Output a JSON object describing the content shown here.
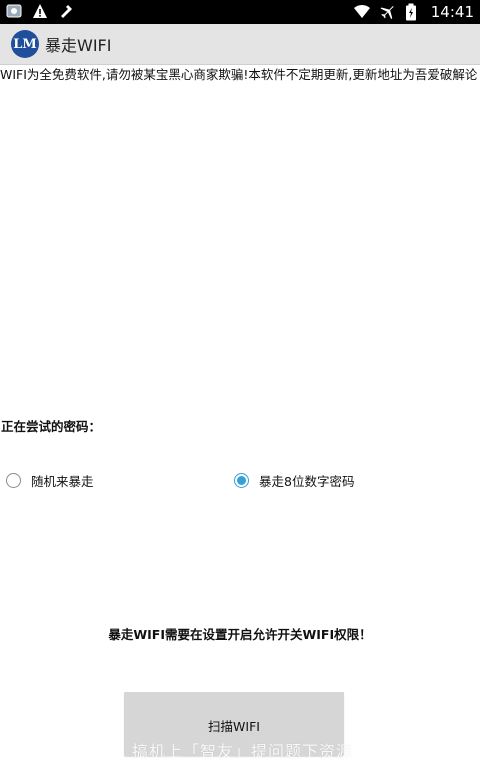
{
  "status_bar": {
    "time": "14:41",
    "left_icons": [
      "gallery-icon",
      "warning-icon",
      "tools-icon"
    ],
    "right_icons": [
      "wifi-icon",
      "airplane-icon",
      "battery-icon"
    ]
  },
  "app": {
    "logo_text": "LM",
    "title": "暴走WIFI",
    "brand_color": "#1f4f9c"
  },
  "notice_text": "WIFI为全免费软件,请勿被某宝黑心商家欺骗!本软件不定期更新,更新地址为吾爱破解论",
  "trying_password_label": "正在尝试的密码：",
  "options": [
    {
      "label": "随机来暴走",
      "checked": false
    },
    {
      "label": "暴走8位数字密码",
      "checked": true
    }
  ],
  "permission_note": "暴走WIFI需要在设置开启允许开关WIFI权限！",
  "scan_button_label": "扫描WIFI",
  "watermark_text": "搞机上「智友」提问题下资源",
  "accent_color": "#33a0d8"
}
